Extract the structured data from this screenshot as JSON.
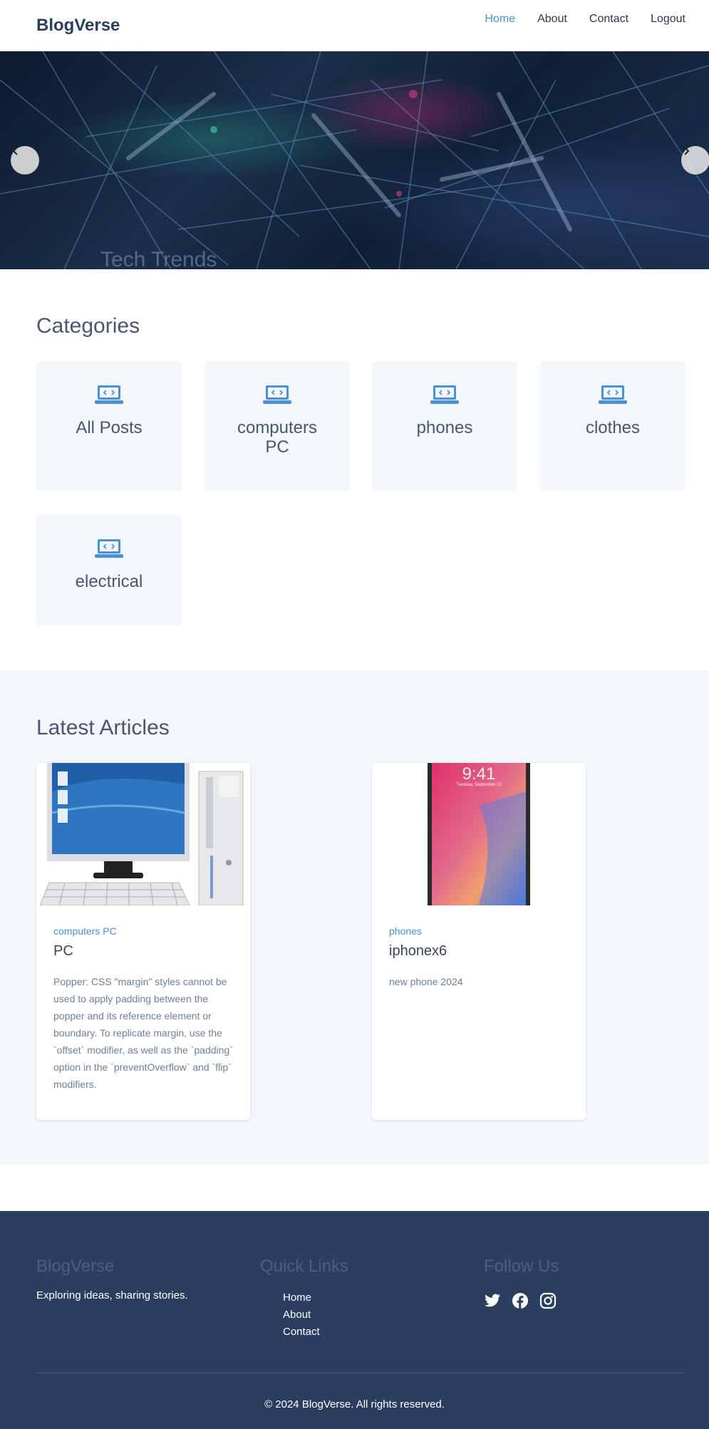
{
  "navbar": {
    "brand": "BlogVerse",
    "links": [
      {
        "label": "Home",
        "active": true
      },
      {
        "label": "About",
        "active": false
      },
      {
        "label": "Contact",
        "active": false
      },
      {
        "label": "Logout",
        "active": false
      }
    ]
  },
  "hero": {
    "caption": "Tech Trends",
    "prev_icon": "chevron-left-icon",
    "next_icon": "chevron-right-icon"
  },
  "categories": {
    "title": "Categories",
    "icon": "laptop-code-icon",
    "accent": "#4a90d9",
    "items": [
      {
        "label": "All Posts"
      },
      {
        "label": "computers PC"
      },
      {
        "label": "phones"
      },
      {
        "label": "clothes"
      },
      {
        "label": "electrical"
      }
    ]
  },
  "articles": {
    "title": "Latest Articles",
    "items": [
      {
        "category": "computers PC",
        "title": "PC",
        "excerpt": "Popper: CSS \"margin\" styles cannot be used to apply padding between the popper and its reference element or boundary. To replicate margin, use the `offset` modifier, as well as the `padding` option in the `preventOverflow` and `flip` modifiers.",
        "image": "desktop-computer-image"
      },
      {
        "category": "phones",
        "title": "iphonex6",
        "excerpt": "new phone 2024",
        "image": "smartphone-image",
        "phone_time": "9:41",
        "phone_date": "Tuesday, September 12"
      }
    ]
  },
  "footer": {
    "brand": "BlogVerse",
    "tagline": "Exploring ideas, sharing stories.",
    "quick_links_title": "Quick Links",
    "quick_links": [
      "Home",
      "About",
      "Contact"
    ],
    "follow_title": "Follow Us",
    "social_icons": [
      "twitter-icon",
      "facebook-icon",
      "instagram-icon"
    ],
    "copyright": "© 2024 BlogVerse. All rights reserved.",
    "background": "#2c3e5f"
  }
}
